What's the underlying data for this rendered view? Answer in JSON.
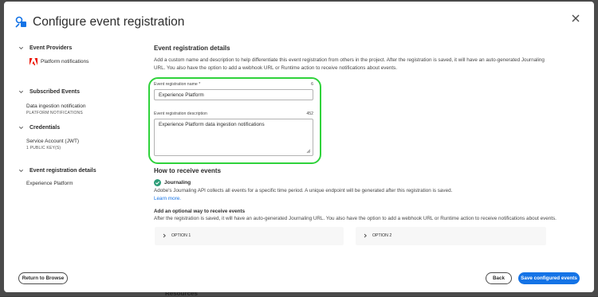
{
  "background": {
    "peek_text": "Resources"
  },
  "dialog": {
    "title": "Configure event registration",
    "close_icon": "close-icon"
  },
  "sidebar": {
    "sections": [
      {
        "heading": "Event Providers",
        "items": [
          {
            "label": "Platform notifications",
            "sub": ""
          }
        ]
      },
      {
        "heading": "Subscribed Events",
        "items": [
          {
            "label": "Data ingestion notification",
            "sub": "PLATFORM NOTIFICATIONS"
          }
        ]
      },
      {
        "heading": "Credentials",
        "items": [
          {
            "label": "Service Account (JWT)",
            "sub": "1 PUBLIC KEY(S)"
          }
        ]
      },
      {
        "heading": "Event registration details",
        "items": [
          {
            "label": "Experience Platform",
            "sub": ""
          }
        ]
      }
    ]
  },
  "main": {
    "heading": "Event registration details",
    "intro": "Add a custom name and description to help differentiate this event registration from others in the project. After the registration is saved, it will have an auto-generated Journaling URL. You also have the option to add a webhook URL or Runtime action to receive notifications about events.",
    "name_field": {
      "label": "Event registration name",
      "required_mark": "*",
      "count": "6",
      "value": "Experience Platform"
    },
    "desc_field": {
      "label": "Event registration description",
      "count": "452",
      "value": "Experience Platform data ingestion notifications"
    },
    "receive": {
      "heading": "How to receive events",
      "journaling_title": "Journaling",
      "journaling_text": "Adobe's Journaling API collects all events for a specific time period. A unique endpoint will be generated after this registration is saved.",
      "learn_more": "Learn more.",
      "optional_heading": "Add an optional way to receive events",
      "optional_text": "After the registration is saved, it will have an auto-generated Journaling URL. You also have the option to add a webhook URL or Runtime action to receive notifications about events.",
      "options": [
        "OPTION 1",
        "OPTION 2"
      ]
    }
  },
  "footer": {
    "return_label": "Return to Browse",
    "back_label": "Back",
    "save_label": "Save configured events"
  },
  "colors": {
    "accent": "#1473e6",
    "highlight": "#2fd23b",
    "success": "#2d9d78",
    "adobe_red": "#eb1000"
  }
}
